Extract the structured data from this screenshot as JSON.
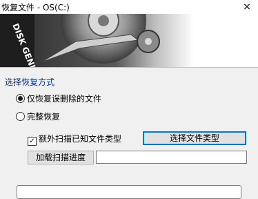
{
  "window": {
    "title": "恢复文件 - OS(C:)",
    "close_glyph": "×"
  },
  "banner": {
    "logo_text": "DISK GENIUS"
  },
  "section": {
    "title": "选择恢复方式"
  },
  "options": {
    "mode_deleted": {
      "label": "仅恢复误删除的文件",
      "checked": true
    },
    "mode_full": {
      "label": "完整恢复",
      "checked": false
    }
  },
  "extra_scan": {
    "label": "额外扫描已知文件类型",
    "checked": true
  },
  "buttons": {
    "select_types": "选择文件类型",
    "load_progress": "加载扫描进度"
  },
  "progress_path": {
    "value": ""
  },
  "colors": {
    "section_title": "#003399",
    "focus_border": "#0078d7"
  }
}
